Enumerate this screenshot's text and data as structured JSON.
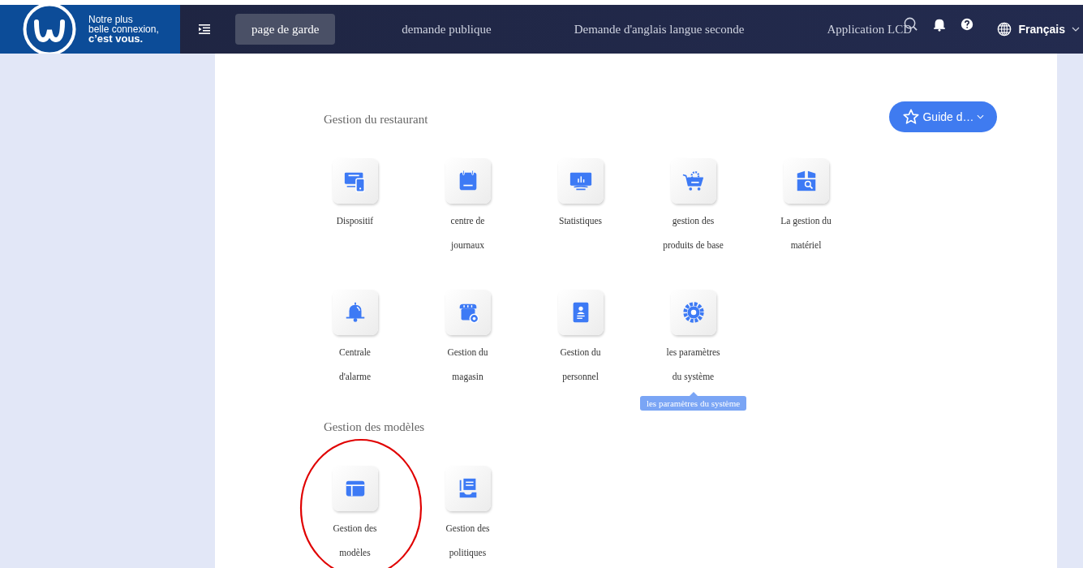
{
  "logo": {
    "lines": [
      "Notre plus",
      "belle connexion,"
    ],
    "emphasis": "c’est vous."
  },
  "tabs": [
    {
      "label": "page de garde",
      "selected": true
    },
    {
      "label": "demande publique",
      "selected": false
    },
    {
      "label": "Demande d'anglais langue seconde",
      "selected": false
    },
    {
      "label": "Application LCD",
      "selected": false
    }
  ],
  "language": "Français",
  "guide_button": "Guide d…",
  "sections": [
    {
      "title": "Gestion du restaurant",
      "items": [
        {
          "label": "Dispositif",
          "circled": false
        },
        {
          "label": "centre de journaux",
          "circled": false
        },
        {
          "label": "Statistiques",
          "circled": false
        },
        {
          "label": "gestion des produits de base",
          "circled": false
        },
        {
          "label": "La gestion du matériel",
          "circled": false
        },
        {
          "label": "Centrale d'alarme",
          "circled": false
        },
        {
          "label": "Gestion du magasin",
          "circled": false
        },
        {
          "label": "Gestion du personnel",
          "circled": false
        },
        {
          "label": "les paramètres du système",
          "circled": false,
          "tooltip": "les paramètres du système"
        }
      ]
    },
    {
      "title": "Gestion des modèles",
      "items": [
        {
          "label": "Gestion des modèles",
          "circled": true
        },
        {
          "label": "Gestion des politiques",
          "circled": false
        }
      ]
    }
  ]
}
